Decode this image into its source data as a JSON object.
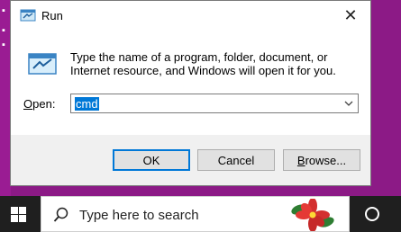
{
  "dialog": {
    "title": "Run",
    "description": "Type the name of a program, folder, document, or Internet resource, and Windows will open it for you.",
    "open_label_prefix": "",
    "open_label_mnemonic": "O",
    "open_label_rest": "pen:",
    "open_value": "cmd",
    "ok_label": "OK",
    "cancel_label": "Cancel",
    "browse_label_prefix": "",
    "browse_label_mnemonic": "B",
    "browse_label_rest": "rowse..."
  },
  "taskbar": {
    "search_placeholder": "Type here to search"
  },
  "colors": {
    "accent": "#0078d7",
    "desktop": "#8c1a86",
    "taskbar": "#1f1f1f"
  }
}
